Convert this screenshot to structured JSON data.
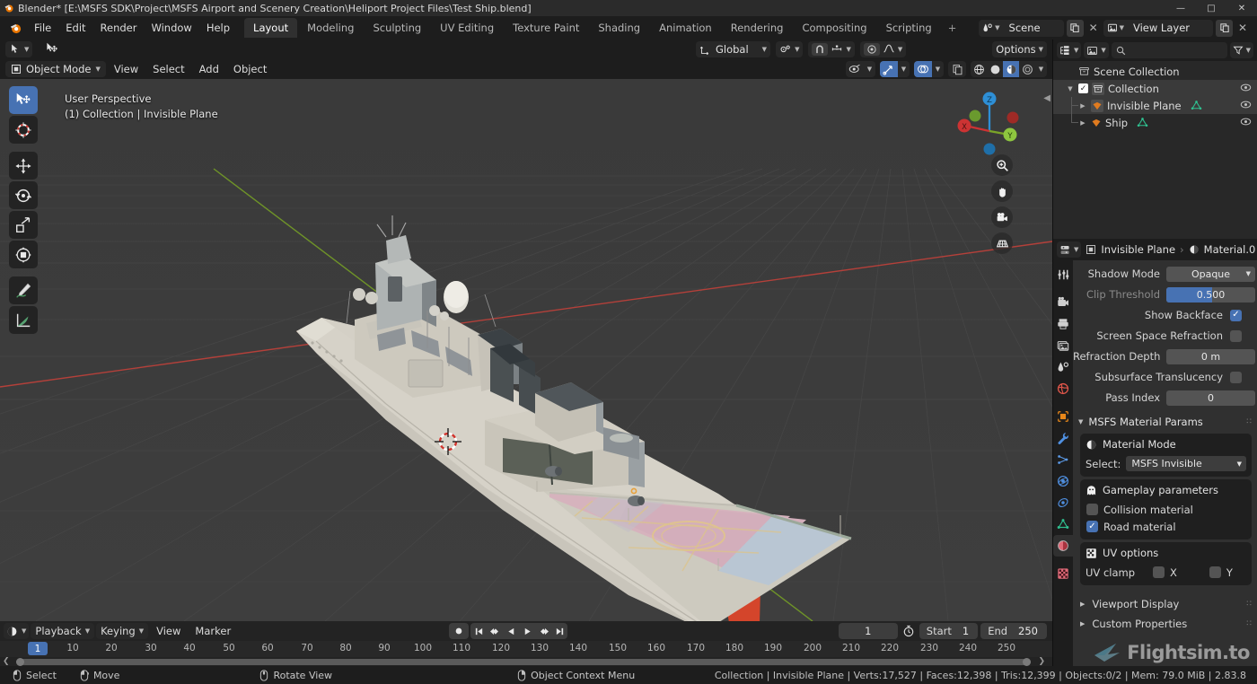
{
  "titlebar": {
    "text": "Blender* [E:\\MSFS SDK\\Project\\MSFS Airport and Scenery Creation\\Heliport Project Files\\Test Ship.blend]",
    "minimize": "—",
    "maximize": "□",
    "close": "✕"
  },
  "menubar": {
    "items": [
      "File",
      "Edit",
      "Render",
      "Window",
      "Help"
    ],
    "workspaces": [
      {
        "label": "Layout",
        "active": true
      },
      {
        "label": "Modeling",
        "active": false
      },
      {
        "label": "Sculpting",
        "active": false
      },
      {
        "label": "UV Editing",
        "active": false
      },
      {
        "label": "Texture Paint",
        "active": false
      },
      {
        "label": "Shading",
        "active": false
      },
      {
        "label": "Animation",
        "active": false
      },
      {
        "label": "Rendering",
        "active": false
      },
      {
        "label": "Compositing",
        "active": false
      },
      {
        "label": "Scripting",
        "active": false
      }
    ],
    "add_workspace": "+",
    "scene_name": "Scene",
    "view_layer_name": "View Layer"
  },
  "viewport_header": {
    "transform_orientation": "Global",
    "options_label": "Options"
  },
  "viewport_header2": {
    "mode": "Object Mode",
    "menus": [
      "View",
      "Select",
      "Add",
      "Object"
    ]
  },
  "viewport": {
    "perspective_label": "User Perspective",
    "object_label": "(1) Collection | Invisible Plane",
    "gizmo_axes": [
      "X",
      "Y",
      "Z"
    ],
    "colors": {
      "bg": "#3b3b3b",
      "x_axis": "#cc3333",
      "y_axis": "#7ba428",
      "z_axis": "#2e8fd6",
      "accent": "#4772b3",
      "ship_hull": "#d8d4ca",
      "ship_hull_red": "#c43a22",
      "ship_super": "#8d9296",
      "helipad_pink": "#d8b3bd",
      "helipad_blue": "#b9c6d3"
    },
    "toolbar": [
      {
        "name": "tweak-tool",
        "active": true
      },
      {
        "name": "cursor-tool",
        "active": false
      },
      {
        "name": "move-tool",
        "active": false
      },
      {
        "name": "rotate-tool",
        "active": false
      },
      {
        "name": "scale-tool",
        "active": false
      },
      {
        "name": "transform-tool",
        "active": false
      },
      {
        "name": "annotate-tool",
        "active": false
      },
      {
        "name": "measure-tool",
        "active": false
      }
    ],
    "nav_buttons": [
      "zoom",
      "pan",
      "camera",
      "ortho-persp"
    ]
  },
  "outliner": {
    "search_placeholder": "",
    "rows": [
      {
        "label": "Scene Collection",
        "level": 0,
        "icon": "collection-icon",
        "selected": false,
        "has_check": false,
        "has_tri": false,
        "has_eye": false
      },
      {
        "label": "Collection",
        "level": 1,
        "icon": "collection-icon",
        "selected": true,
        "has_check": true,
        "has_tri": true,
        "has_eye": true
      },
      {
        "label": "Invisible Plane",
        "level": 2,
        "icon": "mesh-object-icon",
        "selected": true,
        "has_check": false,
        "has_tri": true,
        "has_eye": true,
        "data_icon": "mesh-data-icon"
      },
      {
        "label": "Ship",
        "level": 2,
        "icon": "mesh-object-icon",
        "selected": false,
        "has_check": false,
        "has_tri": true,
        "has_eye": true,
        "data_icon": "mesh-data-icon"
      }
    ]
  },
  "properties": {
    "breadcrumb_object": "Invisible Plane",
    "breadcrumb_material": "Material.0",
    "settings_rows": [
      {
        "label": "Shadow Mode",
        "value": "Opaque",
        "type": "dropdown",
        "dim": false
      },
      {
        "label": "Clip Threshold",
        "value": "0.500",
        "type": "slider",
        "dim": true
      },
      {
        "label": "Show Backface",
        "value": "",
        "type": "checkbox",
        "checked": true,
        "dim": false
      },
      {
        "label": "Screen Space Refraction",
        "value": "",
        "type": "checkbox",
        "checked": false,
        "dim": false
      },
      {
        "label": "Refraction Depth",
        "value": "0 m",
        "type": "number",
        "dim": false
      },
      {
        "label": "Subsurface Translucency",
        "value": "",
        "type": "checkbox",
        "checked": false,
        "dim": false
      },
      {
        "label": "Pass Index",
        "value": "0",
        "type": "number",
        "dim": false
      }
    ],
    "msfs_panel": {
      "title": "MSFS Material Params",
      "material_mode_title": "Material Mode",
      "select_label": "Select:",
      "select_value": "MSFS Invisible",
      "gameplay_title": "Gameplay parameters",
      "collision_label": "Collision material",
      "collision_checked": false,
      "road_label": "Road material",
      "road_checked": true,
      "uv_options_title": "UV options",
      "uv_clamp_label": "UV clamp",
      "uv_clamp_x": "X",
      "uv_clamp_y": "Y",
      "uv_clamp_x_checked": false,
      "uv_clamp_y_checked": false
    },
    "closed_panels": [
      "Viewport Display",
      "Custom Properties"
    ],
    "tabs": [
      {
        "name": "tool-tab",
        "active": false
      },
      {
        "name": "render-tab",
        "active": false
      },
      {
        "name": "output-tab",
        "active": false
      },
      {
        "name": "view-layer-tab",
        "active": false
      },
      {
        "name": "scene-tab",
        "active": false
      },
      {
        "name": "world-tab",
        "active": false
      },
      {
        "name": "object-tab",
        "active": false
      },
      {
        "name": "modifier-tab",
        "active": false
      },
      {
        "name": "particles-tab",
        "active": false
      },
      {
        "name": "physics-tab",
        "active": false
      },
      {
        "name": "constraints-tab",
        "active": false
      },
      {
        "name": "object-data-tab",
        "active": false
      },
      {
        "name": "material-tab",
        "active": true
      },
      {
        "name": "texture-tab",
        "active": false
      }
    ]
  },
  "timeline": {
    "playback_label": "Playback",
    "keying_label": "Keying",
    "view_label": "View",
    "marker_label": "Marker",
    "current_frame": "1",
    "start_label": "Start",
    "start_value": "1",
    "end_label": "End",
    "end_value": "250",
    "current_frame_marker": "1",
    "ticks": [
      10,
      20,
      30,
      40,
      50,
      60,
      70,
      80,
      90,
      100,
      110,
      120,
      130,
      140,
      150,
      160,
      170,
      180,
      190,
      200,
      210,
      220,
      230,
      240,
      250
    ]
  },
  "statusbar": {
    "keys": [
      {
        "icon": "mouse-left-icon",
        "label": "Select"
      },
      {
        "icon": "mouse-move-icon",
        "label": "Move"
      },
      {
        "icon": "mouse-middle-icon",
        "label": "Rotate View"
      },
      {
        "icon": "mouse-right-icon",
        "label": "Object Context Menu"
      }
    ],
    "stats": "Collection | Invisible Plane | Verts:17,527 | Faces:12,398 | Tris:12,399 | Objects:0/2 | Mem: 79.0 MiB | 2.83.8"
  },
  "watermark": {
    "text": "Flightsim.to"
  }
}
